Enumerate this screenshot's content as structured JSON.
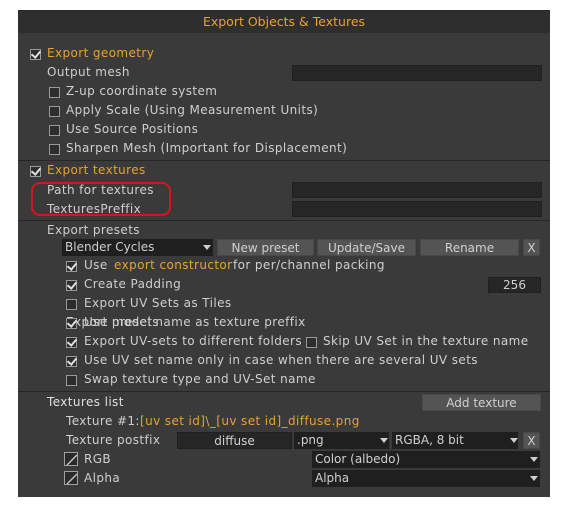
{
  "title": "Export Objects & Textures",
  "geometry": {
    "header": "Export geometry",
    "output_mesh_label": "Output mesh",
    "output_mesh_value": "",
    "options": [
      {
        "label": "Z-up coordinate system",
        "checked": false
      },
      {
        "label": "Apply Scale (Using Measurement Units)",
        "checked": false
      },
      {
        "label": "Use Source Positions",
        "checked": false
      },
      {
        "label": "Sharpen Mesh (Important for Displacement)",
        "checked": false
      }
    ]
  },
  "textures": {
    "header": "Export textures",
    "path_label": "Path for textures",
    "path_value": "",
    "prefix_label": "TexturesPreffix",
    "prefix_value": "",
    "presets_label": "Export presets",
    "preset_selected": "Blender Cycles",
    "new_preset": "New preset",
    "update_save": "Update/Save",
    "rename": "Rename",
    "close": "X",
    "use_label": "Use",
    "constructor_link": "export constructor",
    "constructor_suffix": "for per/channel packing",
    "create_padding": "Create Padding",
    "padding_value": "256",
    "uv_tiles": "Export UV Sets as Tiles",
    "presets_section_label": "Export presets",
    "model_name": "Use model name as texture preffix",
    "uv_folders": "Export UV-sets to different folders",
    "skip_uv": "Skip UV Set in the texture name",
    "uv_name_only": "Use UV set name only in case when there are several UV sets",
    "swap_type": "Swap texture type and UV-Set name"
  },
  "texture_list": {
    "header": "Textures list",
    "add_texture": "Add texture",
    "texture1_label": "Texture #1:",
    "texture1_value": "[uv set id]\\_[uv set id]_diffuse.png",
    "postfix_label": "Texture postfix",
    "postfix_value": "diffuse",
    "ext_value": ".png",
    "format_value": "RGBA, 8 bit",
    "close": "X",
    "rgb_label": "RGB",
    "rgb_value": "Color (albedo)",
    "alpha_label": "Alpha",
    "alpha_value": "Alpha"
  }
}
